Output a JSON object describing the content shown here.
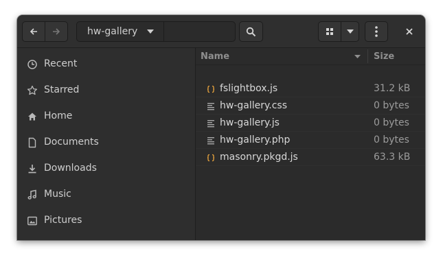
{
  "header": {
    "back_icon": "arrow-left-icon",
    "forward_icon": "arrow-right-icon",
    "path": {
      "current_folder": "hw-gallery"
    },
    "search_icon": "magnifier-icon",
    "view_icon": "grid-icon",
    "view_options_icon": "caret-down-icon",
    "menu_icon": "vertical-dots-icon",
    "close_icon": "x-icon"
  },
  "sidebar": {
    "items": [
      {
        "label": "Recent",
        "icon": "clock-icon"
      },
      {
        "label": "Starred",
        "icon": "star-icon"
      },
      {
        "label": "Home",
        "icon": "home-icon"
      },
      {
        "label": "Documents",
        "icon": "document-icon"
      },
      {
        "label": "Downloads",
        "icon": "download-icon"
      },
      {
        "label": "Music",
        "icon": "music-icon"
      },
      {
        "label": "Pictures",
        "icon": "picture-icon"
      }
    ]
  },
  "file_list": {
    "columns": {
      "name": "Name",
      "size": "Size"
    },
    "rows": [
      {
        "name": "fslightbox.js",
        "size": "31.2 kB",
        "icon": "script-file-icon"
      },
      {
        "name": "hw-gallery.css",
        "size": "0 bytes",
        "icon": "text-file-icon"
      },
      {
        "name": "hw-gallery.js",
        "size": "0 bytes",
        "icon": "text-file-icon"
      },
      {
        "name": "hw-gallery.php",
        "size": "0 bytes",
        "icon": "text-file-icon"
      },
      {
        "name": "masonry.pkgd.js",
        "size": "63.3 kB",
        "icon": "script-file-icon"
      }
    ]
  },
  "colors": {
    "window_bg": "#2d2d2d",
    "script_icon": "#e8a33d",
    "text_icon": "#a8a8a8"
  }
}
